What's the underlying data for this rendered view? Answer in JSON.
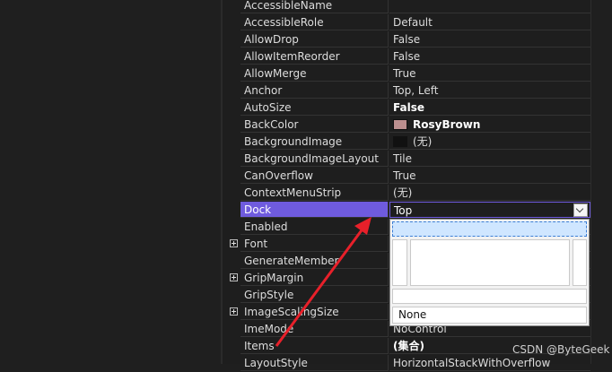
{
  "properties": [
    {
      "name": "AccessibleName",
      "value": ""
    },
    {
      "name": "AccessibleRole",
      "value": "Default"
    },
    {
      "name": "AllowDrop",
      "value": "False"
    },
    {
      "name": "AllowItemReorder",
      "value": "False"
    },
    {
      "name": "AllowMerge",
      "value": "True"
    },
    {
      "name": "Anchor",
      "value": "Top, Left"
    },
    {
      "name": "AutoSize",
      "value": "False",
      "bold": true
    },
    {
      "name": "BackColor",
      "value": "RosyBrown",
      "bold": true,
      "swatch": "#bc8f8f"
    },
    {
      "name": "BackgroundImage",
      "value": "(无)",
      "swatch": "#111111"
    },
    {
      "name": "BackgroundImageLayout",
      "value": "Tile"
    },
    {
      "name": "CanOverflow",
      "value": "True"
    },
    {
      "name": "ContextMenuStrip",
      "value": "(无)"
    },
    {
      "name": "Dock",
      "value": "Top",
      "selected": true
    },
    {
      "name": "Enabled",
      "value": ""
    },
    {
      "name": "Font",
      "value": "",
      "expandable": true
    },
    {
      "name": "GenerateMember",
      "value": ""
    },
    {
      "name": "GripMargin",
      "value": "",
      "expandable": true
    },
    {
      "name": "GripStyle",
      "value": ""
    },
    {
      "name": "ImageScalingSize",
      "value": "",
      "expandable": true
    },
    {
      "name": "ImeMode",
      "value": "NoControl"
    },
    {
      "name": "Items",
      "value": "(集合)",
      "bold": true
    },
    {
      "name": "LayoutStyle",
      "value": "HorizontalStackWithOverflow"
    }
  ],
  "dock_editor": {
    "none_label": "None"
  },
  "watermark": "CSDN @ByteGeek",
  "colors": {
    "selection": "#6f5bde",
    "arrow": "#e8202a"
  }
}
